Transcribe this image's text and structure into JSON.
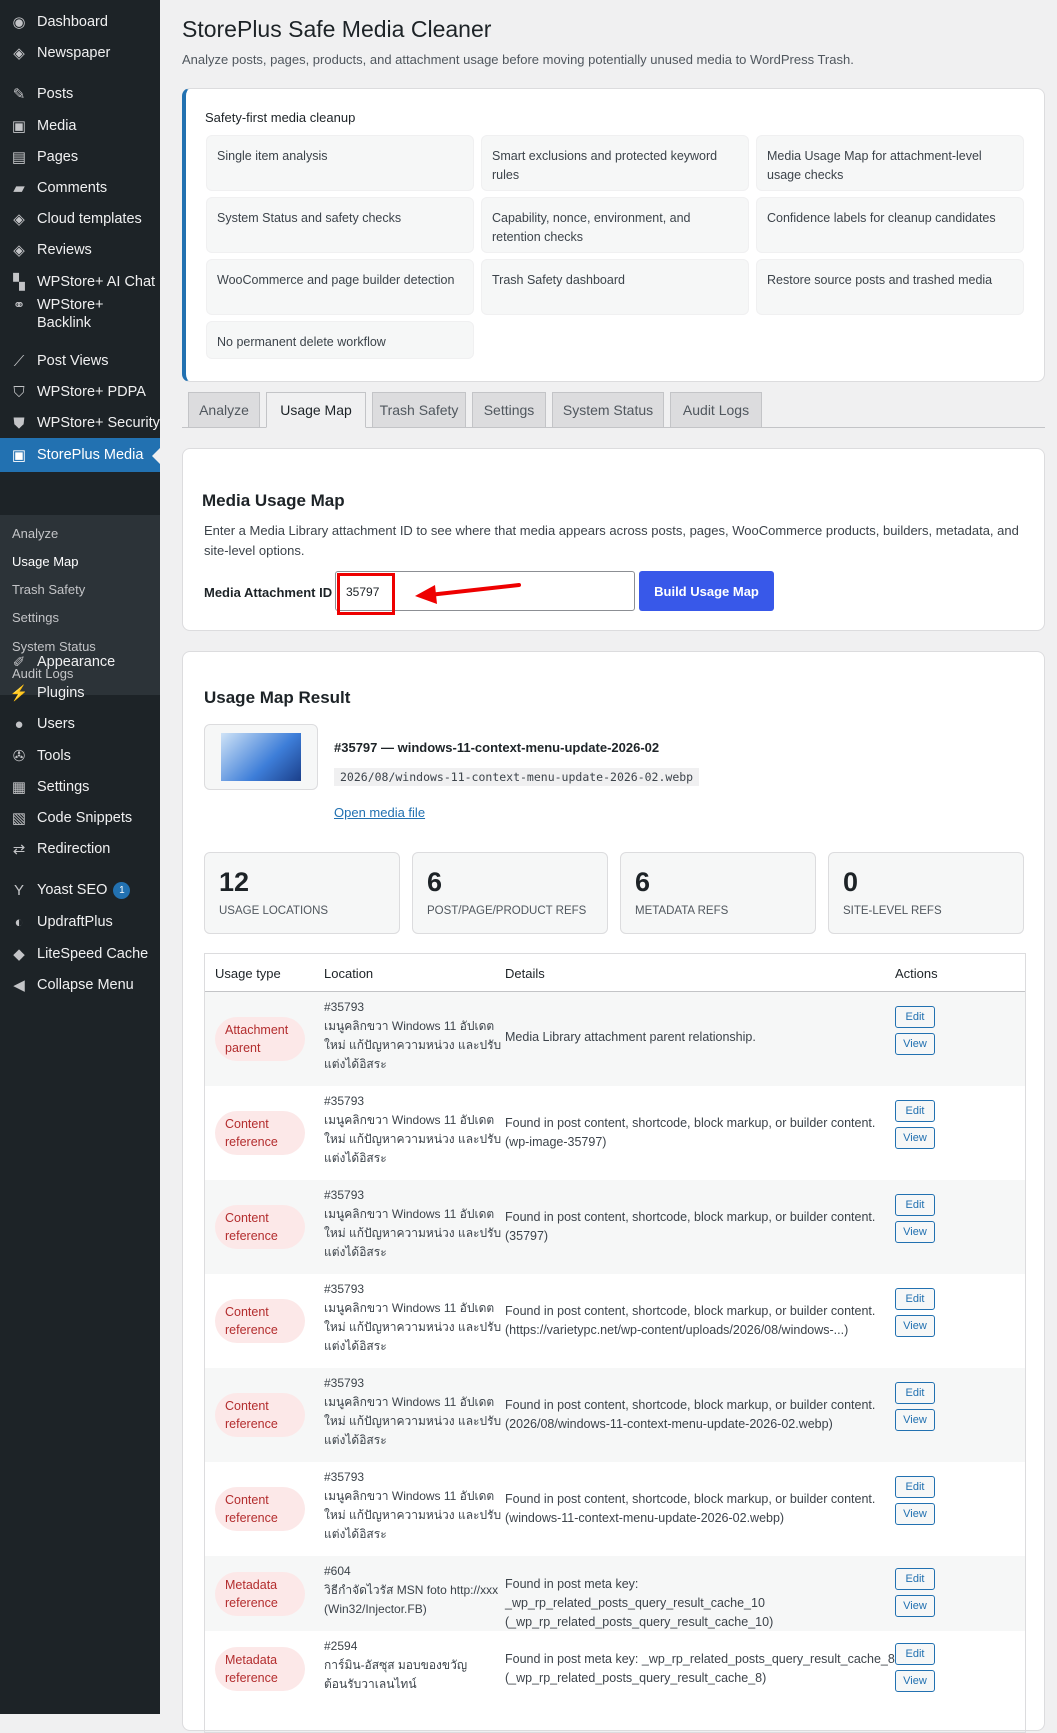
{
  "sidebar": {
    "items": [
      {
        "label": "Dashboard",
        "icon": "dashboard-icon",
        "glyph": "◉"
      },
      {
        "label": "Newspaper",
        "icon": "newspaper-icon",
        "glyph": "◈"
      },
      {
        "label": "Posts",
        "icon": "pin-icon",
        "glyph": "✎"
      },
      {
        "label": "Media",
        "icon": "media-icon",
        "glyph": "▣"
      },
      {
        "label": "Pages",
        "icon": "pages-icon",
        "glyph": "▤"
      },
      {
        "label": "Comments",
        "icon": "comments-icon",
        "glyph": "▰"
      },
      {
        "label": "Cloud templates",
        "icon": "cloud-templates-icon",
        "glyph": "◈"
      },
      {
        "label": "Reviews",
        "icon": "reviews-icon",
        "glyph": "◈"
      },
      {
        "label": "WPStore+ AI Chat",
        "icon": "ai-chat-icon",
        "glyph": "▚"
      },
      {
        "label": "WPStore+ Backlink",
        "icon": "link-icon",
        "glyph": "⚭"
      },
      {
        "label": "Post Views",
        "icon": "chart-icon",
        "glyph": "⟋"
      },
      {
        "label": "WPStore+ PDPA",
        "icon": "pdpa-icon",
        "glyph": "⛉"
      },
      {
        "label": "WPStore+ Security",
        "icon": "shield-icon",
        "glyph": "⛊"
      },
      {
        "label": "StorePlus Media",
        "icon": "media-cleaner-icon",
        "glyph": "▣"
      },
      {
        "label": "Appearance",
        "icon": "brush-icon",
        "glyph": "✐"
      },
      {
        "label": "Plugins",
        "icon": "plugin-icon",
        "glyph": "⚡"
      },
      {
        "label": "Users",
        "icon": "user-icon",
        "glyph": "●"
      },
      {
        "label": "Tools",
        "icon": "wrench-icon",
        "glyph": "✇"
      },
      {
        "label": "Settings",
        "icon": "settings-icon",
        "glyph": "▦"
      },
      {
        "label": "Code Snippets",
        "icon": "code-icon",
        "glyph": "▧"
      },
      {
        "label": "Redirection",
        "icon": "redirect-icon",
        "glyph": "⇄"
      },
      {
        "label": "Yoast SEO",
        "icon": "yoast-icon",
        "glyph": "Y",
        "badge": "1"
      },
      {
        "label": "UpdraftPlus",
        "icon": "updraft-icon",
        "glyph": "◐"
      },
      {
        "label": "LiteSpeed Cache",
        "icon": "litespeed-icon",
        "glyph": "◆"
      },
      {
        "label": "Collapse Menu",
        "icon": "collapse-icon",
        "glyph": "◀"
      }
    ],
    "subitems": [
      "Analyze",
      "Usage Map",
      "Trash Safety",
      "Settings",
      "System Status",
      "Audit Logs"
    ]
  },
  "header": {
    "title": "StorePlus Safe Media Cleaner",
    "subtitle": "Analyze posts, pages, products, and attachment usage before moving potentially unused media to WordPress Trash."
  },
  "safety": {
    "title": "Safety-first media cleanup",
    "features": [
      "Single item analysis",
      "Smart exclusions and protected keyword rules",
      "Media Usage Map for attachment-level usage checks",
      "System Status and safety checks",
      "Capability, nonce, environment, and retention checks",
      "Confidence labels for cleanup candidates",
      "WooCommerce and page builder detection",
      "Trash Safety dashboard",
      "Restore source posts and trashed media",
      "No permanent delete workflow"
    ]
  },
  "tabs": [
    "Analyze",
    "Usage Map",
    "Trash Safety",
    "Settings",
    "System Status",
    "Audit Logs"
  ],
  "usage_map": {
    "title": "Media Usage Map",
    "description": "Enter a Media Library attachment ID to see where that media appears across posts, pages, WooCommerce products, builders, metadata, and site-level options.",
    "field_label": "Media Attachment ID",
    "field_value": "35797",
    "button": "Build Usage Map"
  },
  "result": {
    "title": "Usage Map Result",
    "media_title": "#35797 — windows-11-context-menu-update-2026-02",
    "media_path": "2026/08/windows-11-context-menu-update-2026-02.webp",
    "open_link": "Open media file",
    "stats": [
      {
        "value": "12",
        "label": "USAGE LOCATIONS"
      },
      {
        "value": "6",
        "label": "POST/PAGE/PRODUCT REFS"
      },
      {
        "value": "6",
        "label": "METADATA REFS"
      },
      {
        "value": "0",
        "label": "SITE-LEVEL REFS"
      }
    ],
    "columns": [
      "Usage type",
      "Location",
      "Details",
      "Actions"
    ],
    "edit_label": "Edit",
    "view_label": "View",
    "rows": [
      {
        "type": "Attachment parent",
        "id": "#35793",
        "title": "เมนูคลิกขวา Windows 11 อัปเดตใหม่ แก้ปัญหาความหน่วง และปรับแต่งได้อิสระ",
        "detail": "Media Library attachment parent relationship."
      },
      {
        "type": "Content reference",
        "id": "#35793",
        "title": "เมนูคลิกขวา Windows 11 อัปเดตใหม่ แก้ปัญหาความหน่วง และปรับแต่งได้อิสระ",
        "detail": "Found in post content, shortcode, block markup, or builder content. (wp-image-35797)"
      },
      {
        "type": "Content reference",
        "id": "#35793",
        "title": "เมนูคลิกขวา Windows 11 อัปเดตใหม่ แก้ปัญหาความหน่วง และปรับแต่งได้อิสระ",
        "detail": "Found in post content, shortcode, block markup, or builder content. (35797)"
      },
      {
        "type": "Content reference",
        "id": "#35793",
        "title": "เมนูคลิกขวา Windows 11 อัปเดตใหม่ แก้ปัญหาความหน่วง และปรับแต่งได้อิสระ",
        "detail": "Found in post content, shortcode, block markup, or builder content. (https://varietypc.net/wp-content/uploads/2026/08/windows-...)"
      },
      {
        "type": "Content reference",
        "id": "#35793",
        "title": "เมนูคลิกขวา Windows 11 อัปเดตใหม่ แก้ปัญหาความหน่วง และปรับแต่งได้อิสระ",
        "detail": "Found in post content, shortcode, block markup, or builder content. (2026/08/windows-11-context-menu-update-2026-02.webp)"
      },
      {
        "type": "Content reference",
        "id": "#35793",
        "title": "เมนูคลิกขวา Windows 11 อัปเดตใหม่ แก้ปัญหาความหน่วง และปรับแต่งได้อิสระ",
        "detail": "Found in post content, shortcode, block markup, or builder content. (windows-11-context-menu-update-2026-02.webp)"
      },
      {
        "type": "Metadata reference",
        "id": "#604",
        "title": "วิธีกำจัดไวรัส MSN foto http://xxx (Win32/Injector.FB)",
        "detail": "Found in post meta key: _wp_rp_related_posts_query_result_cache_10 (_wp_rp_related_posts_query_result_cache_10)"
      },
      {
        "type": "Metadata reference",
        "id": "#2594",
        "title": "การ์มิน-อัสซุส มอบของขวัญต้อนรับวาเลนไทน์",
        "detail": "Found in post meta key: _wp_rp_related_posts_query_result_cache_8 (_wp_rp_related_posts_query_result_cache_8)"
      }
    ]
  }
}
